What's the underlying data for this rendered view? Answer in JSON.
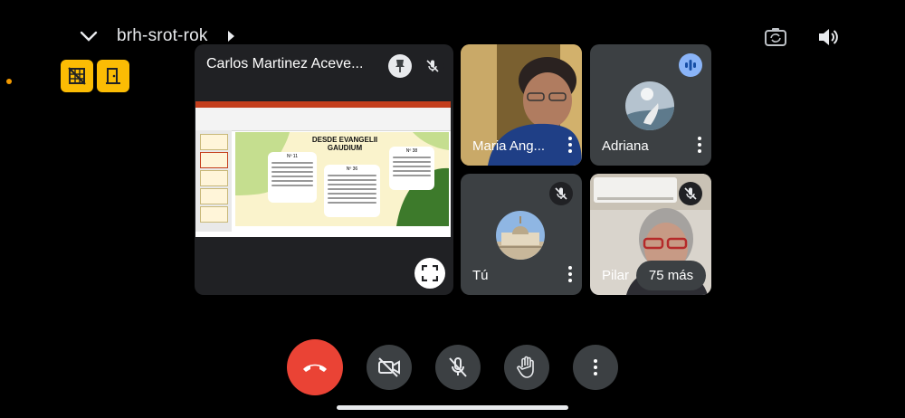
{
  "meeting": {
    "code": "brh-srot-rok"
  },
  "tiles": {
    "presenter": {
      "name": "Carlos Martinez Aceve..."
    },
    "maria": {
      "name": "Maria Ang..."
    },
    "adriana": {
      "name": "Adriana"
    },
    "you": {
      "name": "Tú"
    },
    "pilar": {
      "name": "Pilar",
      "more_label": "75 más"
    }
  },
  "slide": {
    "title": "DESDE EVANGELII GAUDIUM",
    "card_labels": [
      "Nº 11",
      "Nº 36",
      "Nº 38"
    ]
  },
  "colors": {
    "hangup": "#ea4335",
    "accent_yellow": "#fbbc04",
    "tile_bg": "#3c4043",
    "speaking_badge": "#8ab4f8"
  },
  "icons": {
    "top": [
      "chevron-down-icon",
      "switch-camera-icon",
      "speaker-icon"
    ],
    "controls": [
      "end-call-icon",
      "camera-off-icon",
      "mic-off-icon",
      "raise-hand-icon",
      "more-options-icon"
    ]
  }
}
